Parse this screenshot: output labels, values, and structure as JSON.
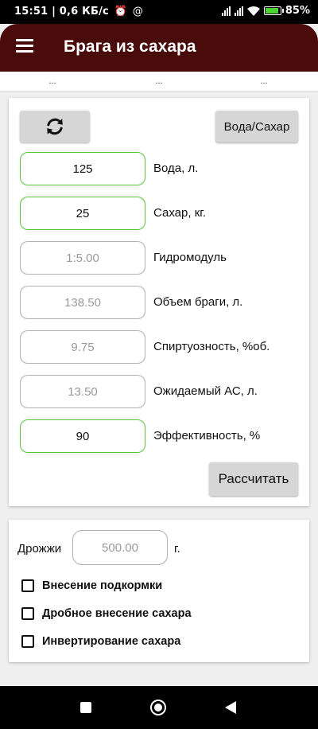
{
  "status_bar": {
    "time": "15:51",
    "network_speed": "| 0,6 КБ/с",
    "alarm_icon": "alarm-icon",
    "at_icon": "at-icon",
    "battery": "85%"
  },
  "app_bar": {
    "title": "Брага из сахара",
    "menu_icon": "hamburger-menu-icon"
  },
  "tabs": [
    {
      "label": "..."
    },
    {
      "label": "..."
    },
    {
      "label": "..."
    }
  ],
  "card_main": {
    "refresh_icon": "refresh-icon",
    "water_sugar_button": "Вода/Сахар",
    "fields": [
      {
        "value": "125",
        "label": "Вода, л.",
        "editable": true
      },
      {
        "value": "25",
        "label": "Сахар, кг.",
        "editable": true
      },
      {
        "value": "1:5.00",
        "label": "Гидромодуль",
        "editable": false
      },
      {
        "value": "138.50",
        "label": "Объем браги, л.",
        "editable": false
      },
      {
        "value": "9.75",
        "label": "Спиртуозность, %об.",
        "editable": false
      },
      {
        "value": "13.50",
        "label": "Ожидаемый АС, л.",
        "editable": false
      },
      {
        "value": "90",
        "label": "Эффективность, %",
        "editable": true
      }
    ],
    "calculate_button": "Рассчитать"
  },
  "card_yeast": {
    "label": "Дрожжи",
    "placeholder": "500.00",
    "unit": "г.",
    "checkboxes": [
      {
        "label": "Внесение подкормки",
        "checked": false
      },
      {
        "label": "Дробное внесение сахара",
        "checked": false
      },
      {
        "label": "Инвертирование сахара",
        "checked": false
      }
    ]
  },
  "colors": {
    "app_bar": "#4a0b0b",
    "editable_border": "#5ac33c",
    "readonly_text": "#9a9a9a",
    "background": "#efefef"
  }
}
